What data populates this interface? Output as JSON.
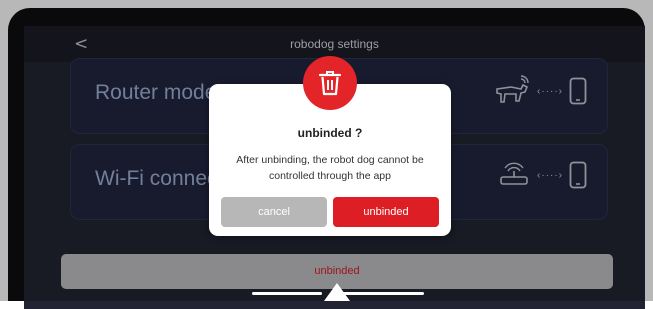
{
  "header": {
    "back_glyph": "<",
    "title": "robodog settings"
  },
  "cards": [
    {
      "label": "Router mode",
      "icons": [
        "robot-dog-icon",
        "dots-icon",
        "phone-icon"
      ]
    },
    {
      "label": "Wi-Fi connect",
      "icons": [
        "wifi-router-icon",
        "dots-icon",
        "phone-icon"
      ]
    }
  ],
  "dots_text": "‹····›",
  "bottom_button": {
    "label": "unbinded"
  },
  "dialog": {
    "icon": "trash-icon",
    "title": "unbinded ?",
    "message": "After unbinding, the robot dog cannot be controlled through the app",
    "cancel_label": "cancel",
    "confirm_label": "unbinded"
  },
  "colors": {
    "accent_red": "#dd1e24",
    "cancel_gray": "#b7b7b7",
    "screen_bg": "#222433",
    "card_bg": "#222640"
  }
}
